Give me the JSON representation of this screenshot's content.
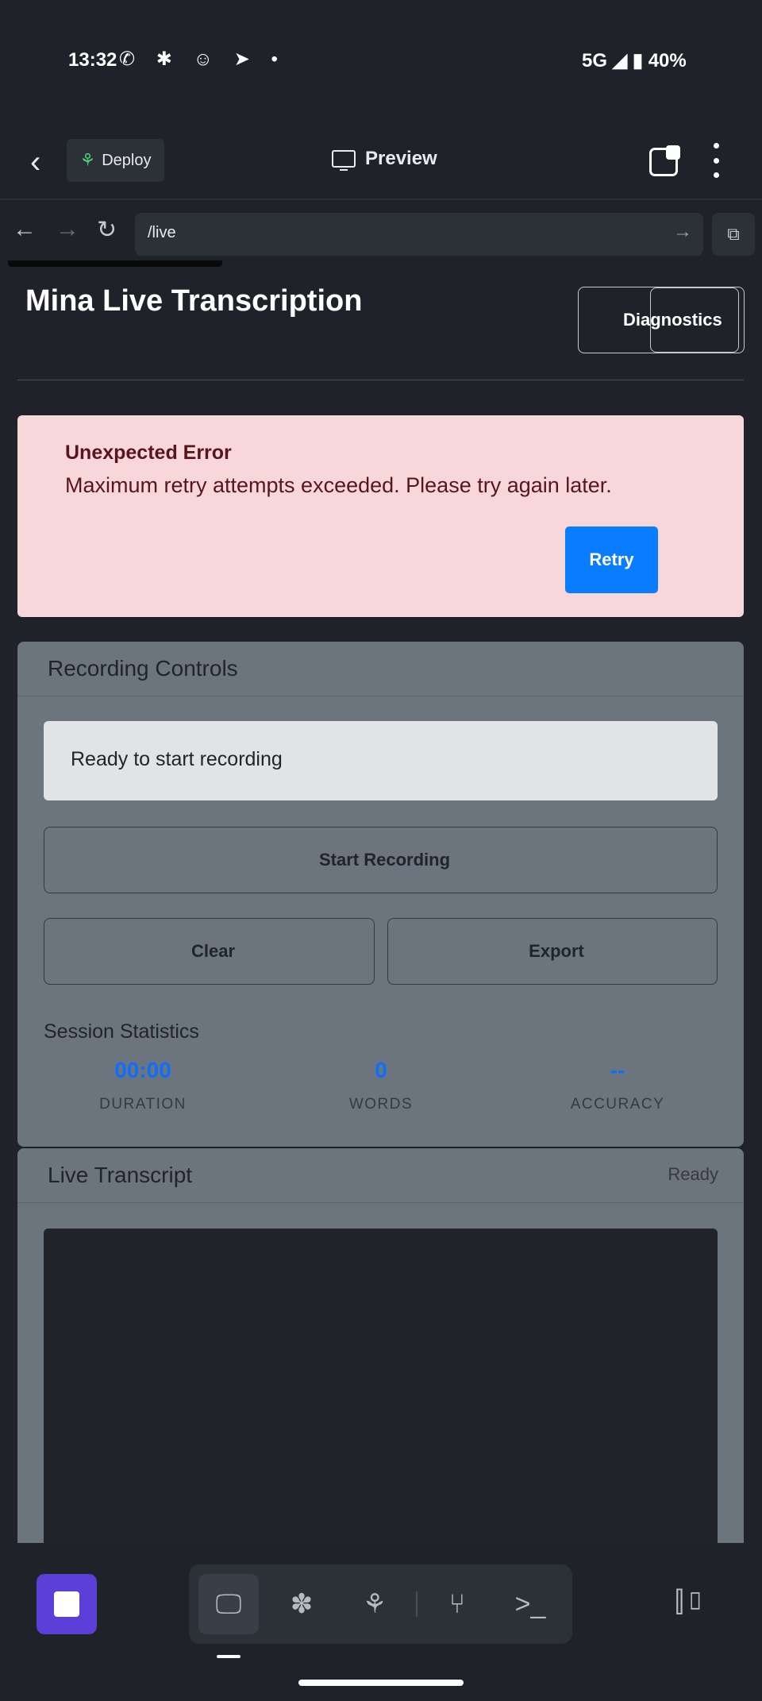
{
  "status_bar": {
    "time": "13:32",
    "notification_icons": "✆ ✱ ☺ ➤ •",
    "network": "5G",
    "battery": "40%"
  },
  "app_bar": {
    "deploy_label": "Deploy",
    "preview_label": "Preview"
  },
  "browser": {
    "url": "/live"
  },
  "page": {
    "title": "Mina Live Transcription",
    "title_icon": "",
    "diagnostics_label": "Diagnostics",
    "diagnostics_icon": "",
    "error": {
      "icon": "",
      "title": "Unexpected Error",
      "message": "Maximum retry attempts exceeded. Please try again later.",
      "retry_label": "Retry"
    },
    "recording_controls": {
      "title": "Recording Controls",
      "icon": "",
      "status_text": "Ready to start recording",
      "status_icon": "",
      "start_label": "Start Recording",
      "start_icon": "",
      "clear_label": "Clear",
      "clear_icon": "",
      "export_label": "Export",
      "export_icon": "",
      "stats_title": "Session Statistics",
      "stats": [
        {
          "value": "00:00",
          "label": "DURATION"
        },
        {
          "value": "0",
          "label": "WORDS"
        },
        {
          "value": "--",
          "label": "ACCURACY"
        }
      ]
    },
    "live_transcript": {
      "title": "Live Transcript",
      "icon": "",
      "status": "Ready",
      "status_icon": ""
    }
  },
  "colors": {
    "error_bg": "#f8d7da",
    "primary": "#0a7cff",
    "card_bg": "#6c757d",
    "stat_value": "#0d6efd",
    "stop_button": "#5b3fd6"
  }
}
